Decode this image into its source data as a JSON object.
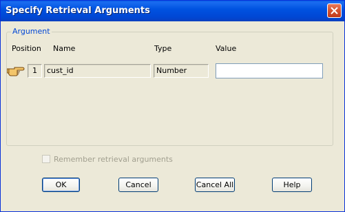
{
  "window": {
    "title": "Specify Retrieval Arguments"
  },
  "group": {
    "label": "Argument",
    "headers": {
      "position": "Position",
      "name": "Name",
      "type": "Type",
      "value": "Value"
    }
  },
  "argument": {
    "position": "1",
    "name": "cust_id",
    "type": "Number",
    "value": ""
  },
  "remember": {
    "label": "Remember retrieval arguments",
    "checked": false,
    "enabled": false
  },
  "buttons": {
    "ok": "OK",
    "cancel": "Cancel",
    "cancel_all": "Cancel All",
    "help": "Help"
  },
  "icons": {
    "current_row": "hand-pointer-icon",
    "close": "close-icon"
  },
  "colors": {
    "title_bar": "#0053e1",
    "group_label": "#0046d5",
    "dialog_bg": "#ece9d8",
    "close_button": "#d5532e"
  }
}
